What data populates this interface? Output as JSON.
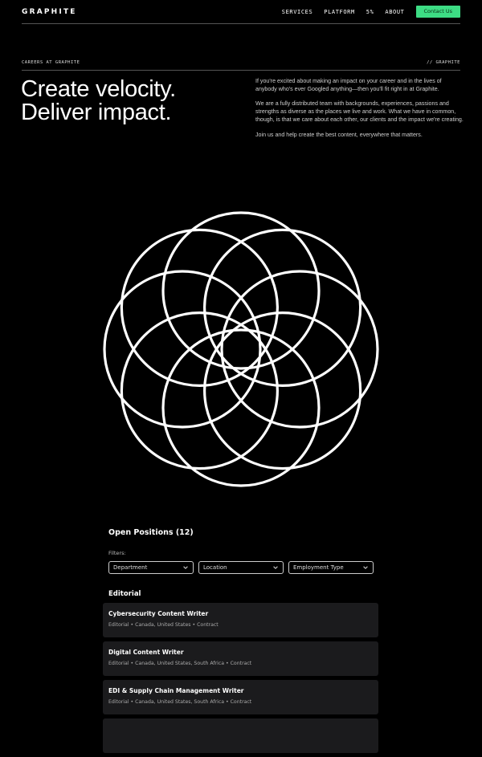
{
  "header": {
    "logo": "GRAPHITE",
    "nav": [
      "SERVICES",
      "PLATFORM",
      "5%",
      "ABOUT"
    ],
    "cta": "Contact Us",
    "cta_color": "#3ddc84"
  },
  "section": {
    "left_label": "CAREERS AT GRAPHITE",
    "right_label": "// GRAPHITE"
  },
  "hero": {
    "headline_line1": "Create velocity.",
    "headline_line2": "Deliver impact.",
    "paragraphs": [
      "If you're excited about making an impact on your career and in the lives of anybody who's ever Googled anything—then you'll fit right in at Graphite.",
      "We are a fully distributed team with backgrounds, experiences, passions and strengths as diverse as the places we live and work. What we have in common, though, is that we care about each other, our clients and the impact we're creating.",
      "Join us and help create the best content, everywhere that matters."
    ]
  },
  "graphic": {
    "icon": "flower-of-life-icon"
  },
  "positions": {
    "title": "Open Positions (12)",
    "filters_label": "Filters:",
    "filters": [
      "Department",
      "Location",
      "Employment Type"
    ],
    "department": "Editorial",
    "jobs": [
      {
        "title": "Cybersecurity Content Writer",
        "meta": "Editorial • Canada, United States • Contract"
      },
      {
        "title": "Digital Content Writer",
        "meta": "Editorial • Canada, United States, South Africa • Contract"
      },
      {
        "title": "EDI & Supply Chain Management Writer",
        "meta": "Editorial • Canada, United States, South Africa • Contract"
      },
      {
        "title": "",
        "meta": ""
      }
    ]
  }
}
